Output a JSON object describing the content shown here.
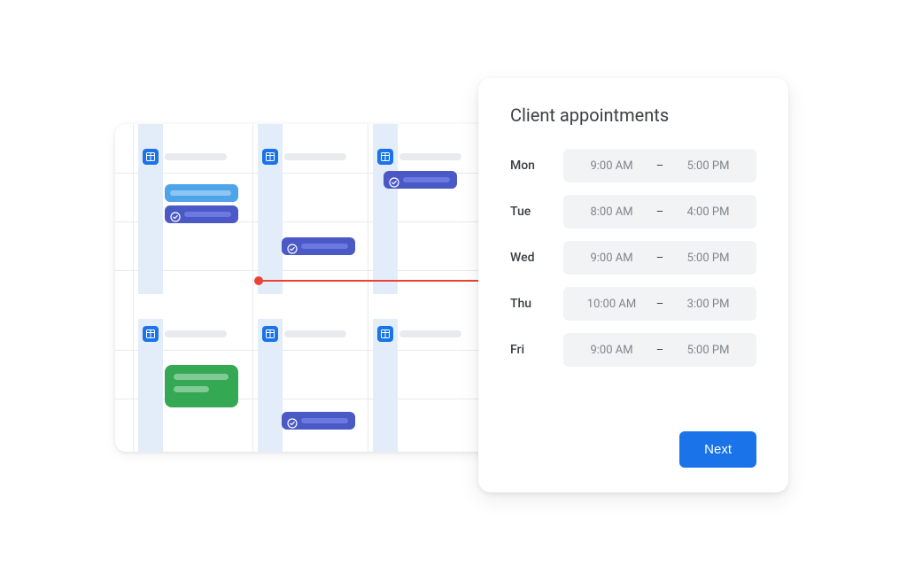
{
  "panel": {
    "title": "Client appointments",
    "next_label": "Next",
    "schedule": [
      {
        "day": "Mon",
        "start": "9:00 AM",
        "end": "5:00 PM"
      },
      {
        "day": "Tue",
        "start": "8:00 AM",
        "end": "4:00 PM"
      },
      {
        "day": "Wed",
        "start": "9:00 AM",
        "end": "5:00 PM"
      },
      {
        "day": "Thu",
        "start": "10:00 AM",
        "end": "3:00 PM"
      },
      {
        "day": "Fri",
        "start": "9:00 AM",
        "end": "5:00 PM"
      }
    ]
  },
  "calendar": {
    "icons": {
      "day_header": "grid-calendar-icon",
      "event_check": "check-circle-icon"
    },
    "colors": {
      "blue": "#1a73e8",
      "light_blue_col": "#e3edf9",
      "event_indigo": "#4a59c6",
      "event_indigo_bar": "#6b79e0",
      "event_sky": "#4ea4eb",
      "event_sky_bar": "#8cc6f2",
      "green": "#34a853",
      "red": "#ea4335"
    }
  }
}
